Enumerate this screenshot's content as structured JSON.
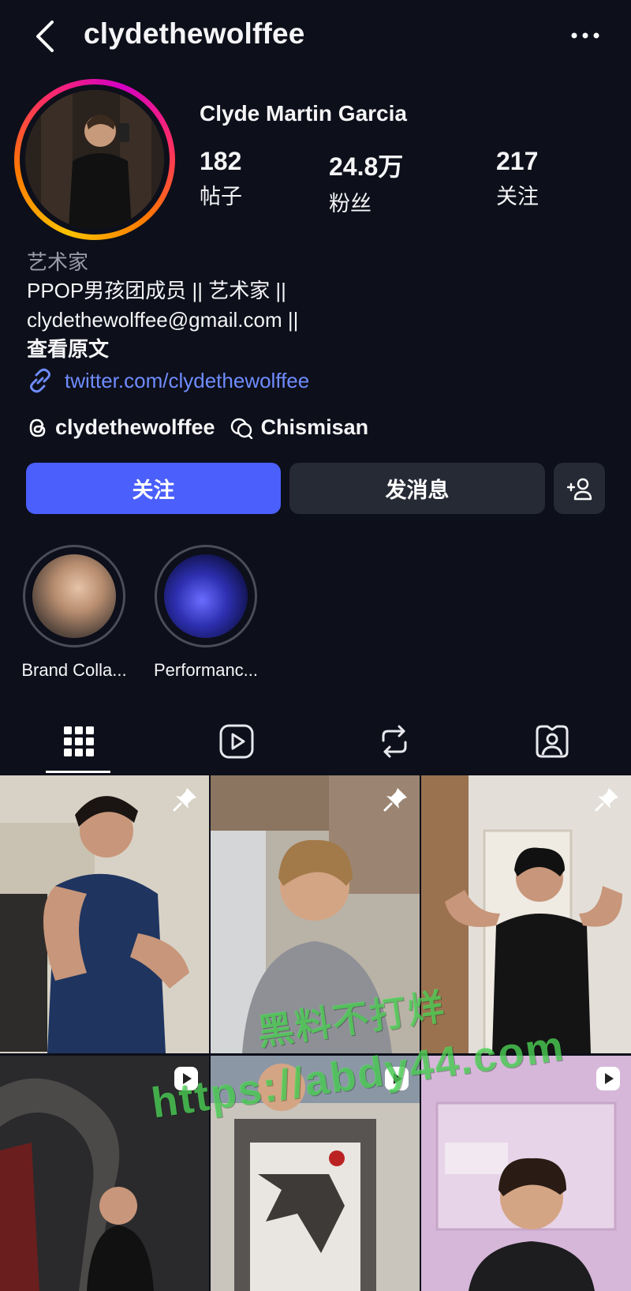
{
  "header": {
    "username": "clydethewolffee"
  },
  "profile": {
    "full_name": "Clyde Martin Garcia",
    "stats": [
      {
        "value": "182",
        "label": "帖子"
      },
      {
        "value": "24.8万",
        "label": "粉丝"
      },
      {
        "value": "217",
        "label": "关注"
      }
    ],
    "category": "艺术家",
    "bio_lines": [
      "PPOP男孩团成员 || 艺术家 ||",
      "clydethewolffee@gmail.com ||"
    ],
    "see_translation": "查看原文",
    "link": "twitter.com/clydethewolffee",
    "threads_handle": "clydethewolffee",
    "extra_handle": "Chismisan"
  },
  "actions": {
    "follow": "关注",
    "message": "发消息"
  },
  "highlights": [
    {
      "label": "Brand Colla..."
    },
    {
      "label": "Performanc..."
    }
  ],
  "tabs": [
    "grid-icon",
    "reels-icon",
    "reposts-icon",
    "tagged-icon"
  ],
  "watermark": {
    "line1": "黑料不打烊",
    "line2": "https://abdy44.com"
  },
  "colors": {
    "accent": "#4a5ffb",
    "link": "#6f8cff",
    "background": "#0d0f1a"
  }
}
